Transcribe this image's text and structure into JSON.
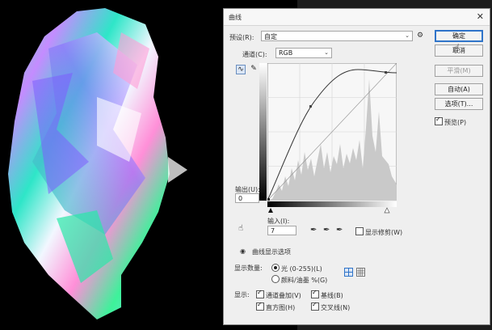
{
  "dialog": {
    "title": "曲线",
    "close_icon": "close-icon"
  },
  "preset": {
    "label": "预设(R):",
    "value": "自定",
    "gear_icon": "gear-icon"
  },
  "channel": {
    "label": "通道(C):",
    "value": "RGB"
  },
  "buttons": {
    "ok": "确定",
    "cancel": "取消",
    "smooth": "平滑(M)",
    "auto": "自动(A)",
    "options": "选项(T)..."
  },
  "preview": {
    "label": "预览(P)",
    "checked": true
  },
  "output": {
    "label": "输出(U):",
    "value": "0"
  },
  "input": {
    "label": "输入(I):",
    "value": "7"
  },
  "show_clipping": {
    "label": "显示修剪(W)",
    "checked": false
  },
  "curve_display_options": {
    "label": "曲线显示选项"
  },
  "show_amount": {
    "label": "显示数量:",
    "light_label": "光 (0-255)(L)",
    "pigment_label": "颜料/油墨 %(G)",
    "selected": "light"
  },
  "show": {
    "label": "显示:",
    "channel_overlays": "通道叠加(V)",
    "baseline": "基线(B)",
    "histogram": "直方图(H)",
    "intersection_line": "交叉线(N)"
  },
  "colors": {
    "accent": "#2f74c9",
    "background": "#000000",
    "dialog_bg": "#efefef"
  },
  "overlay": {
    "play_icon": "play-icon"
  }
}
